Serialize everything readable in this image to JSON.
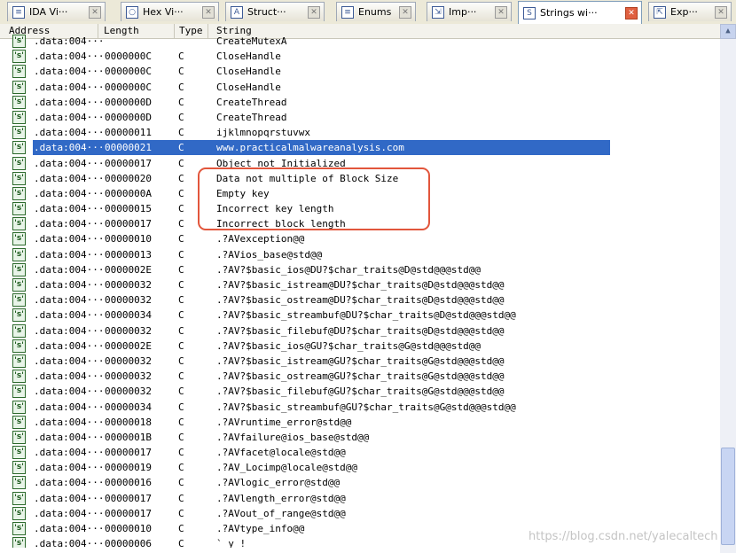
{
  "tabs": [
    {
      "label": "IDA Vi···",
      "icon": "ida-view-icon",
      "glyph": "≡",
      "active": false
    },
    {
      "label": "Hex Vi···",
      "icon": "hex-view-icon",
      "glyph": "○",
      "active": false
    },
    {
      "label": "Struct···",
      "icon": "structures-icon",
      "glyph": "A",
      "active": false
    },
    {
      "label": "Enums",
      "icon": "enums-icon",
      "glyph": "≡",
      "active": false
    },
    {
      "label": "Imp···",
      "icon": "imports-icon",
      "glyph": "⇲",
      "active": false
    },
    {
      "label": "Strings wi···",
      "icon": "strings-window-icon",
      "glyph": "S",
      "active": true
    },
    {
      "label": "Exp···",
      "icon": "exports-icon",
      "glyph": "⇱",
      "active": false
    }
  ],
  "columns": {
    "address": "Address",
    "length": "Length",
    "type": "Type",
    "string": "String"
  },
  "row_icon_glyph": "'s'",
  "rows": [
    {
      "address": ".data:004···",
      "length": "",
      "type": "",
      "string": "CreateMutexA"
    },
    {
      "address": ".data:004···",
      "length": "0000000C",
      "type": "C",
      "string": "CloseHandle"
    },
    {
      "address": ".data:004···",
      "length": "0000000C",
      "type": "C",
      "string": "CloseHandle"
    },
    {
      "address": ".data:004···",
      "length": "0000000C",
      "type": "C",
      "string": "CloseHandle"
    },
    {
      "address": ".data:004···",
      "length": "0000000D",
      "type": "C",
      "string": "CreateThread"
    },
    {
      "address": ".data:004···",
      "length": "0000000D",
      "type": "C",
      "string": "CreateThread"
    },
    {
      "address": ".data:004···",
      "length": "00000011",
      "type": "C",
      "string": "ijklmnopqrstuvwx"
    },
    {
      "address": ".data:004···",
      "length": "00000021",
      "type": "C",
      "string": "www.practicalmalwareanalysis.com",
      "selected": true
    },
    {
      "address": ".data:004···",
      "length": "00000017",
      "type": "C",
      "string": "Object not Initialized"
    },
    {
      "address": ".data:004···",
      "length": "00000020",
      "type": "C",
      "string": "Data not multiple of Block Size"
    },
    {
      "address": ".data:004···",
      "length": "0000000A",
      "type": "C",
      "string": "Empty key"
    },
    {
      "address": ".data:004···",
      "length": "00000015",
      "type": "C",
      "string": "Incorrect key length"
    },
    {
      "address": ".data:004···",
      "length": "00000017",
      "type": "C",
      "string": "Incorrect block length"
    },
    {
      "address": ".data:004···",
      "length": "00000010",
      "type": "C",
      "string": ".?AVexception@@"
    },
    {
      "address": ".data:004···",
      "length": "00000013",
      "type": "C",
      "string": ".?AVios_base@std@@"
    },
    {
      "address": ".data:004···",
      "length": "0000002E",
      "type": "C",
      "string": ".?AV?$basic_ios@DU?$char_traits@D@std@@@std@@"
    },
    {
      "address": ".data:004···",
      "length": "00000032",
      "type": "C",
      "string": ".?AV?$basic_istream@DU?$char_traits@D@std@@@std@@"
    },
    {
      "address": ".data:004···",
      "length": "00000032",
      "type": "C",
      "string": ".?AV?$basic_ostream@DU?$char_traits@D@std@@@std@@"
    },
    {
      "address": ".data:004···",
      "length": "00000034",
      "type": "C",
      "string": ".?AV?$basic_streambuf@DU?$char_traits@D@std@@@std@@"
    },
    {
      "address": ".data:004···",
      "length": "00000032",
      "type": "C",
      "string": ".?AV?$basic_filebuf@DU?$char_traits@D@std@@@std@@"
    },
    {
      "address": ".data:004···",
      "length": "0000002E",
      "type": "C",
      "string": ".?AV?$basic_ios@GU?$char_traits@G@std@@@std@@"
    },
    {
      "address": ".data:004···",
      "length": "00000032",
      "type": "C",
      "string": ".?AV?$basic_istream@GU?$char_traits@G@std@@@std@@"
    },
    {
      "address": ".data:004···",
      "length": "00000032",
      "type": "C",
      "string": ".?AV?$basic_ostream@GU?$char_traits@G@std@@@std@@"
    },
    {
      "address": ".data:004···",
      "length": "00000032",
      "type": "C",
      "string": ".?AV?$basic_filebuf@GU?$char_traits@G@std@@@std@@"
    },
    {
      "address": ".data:004···",
      "length": "00000034",
      "type": "C",
      "string": ".?AV?$basic_streambuf@GU?$char_traits@G@std@@@std@@"
    },
    {
      "address": ".data:004···",
      "length": "00000018",
      "type": "C",
      "string": ".?AVruntime_error@std@@"
    },
    {
      "address": ".data:004···",
      "length": "0000001B",
      "type": "C",
      "string": ".?AVfailure@ios_base@std@@"
    },
    {
      "address": ".data:004···",
      "length": "00000017",
      "type": "C",
      "string": ".?AVfacet@locale@std@@"
    },
    {
      "address": ".data:004···",
      "length": "00000019",
      "type": "C",
      "string": ".?AV_Locimp@locale@std@@"
    },
    {
      "address": ".data:004···",
      "length": "00000016",
      "type": "C",
      "string": ".?AVlogic_error@std@@"
    },
    {
      "address": ".data:004···",
      "length": "00000017",
      "type": "C",
      "string": ".?AVlength_error@std@@"
    },
    {
      "address": ".data:004···",
      "length": "00000017",
      "type": "C",
      "string": ".?AVout_of_range@std@@"
    },
    {
      "address": ".data:004···",
      "length": "00000010",
      "type": "C",
      "string": ".?AVtype_info@@"
    },
    {
      "address": ".data:004···",
      "length": "00000006",
      "type": "C",
      "string": "` y  !"
    }
  ],
  "scrollbar": {
    "up_glyph": "▲",
    "down_glyph": "▼"
  },
  "watermark": "https://blog.csdn.net/yalecaltech",
  "colors": {
    "selection": "#3169c6",
    "highlight_box": "#e2563c",
    "tab_close_active": "#e06040"
  }
}
